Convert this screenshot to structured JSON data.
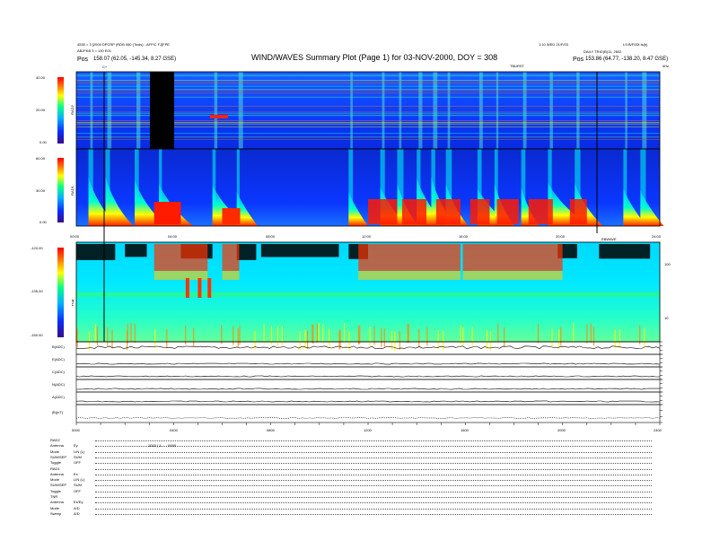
{
  "header": {
    "title": "WIND/WAVES Summary Plot (Page 1) for 03-NOV-2000, DOY = 308",
    "left_line1": "4530 = 3 [2000 DPCRP (RDB 060 (Tools) - AFFIC FJ]FPE",
    "left_line2": "ABJFKB 3 = 130 E01",
    "left_pos_label": "Pos",
    "left_pos_value": "158.07 (62.05, -145.34, 8.27 GSE)",
    "right_line1": "1:10 WED 21/F/03",
    "right_line1b": "LS:B/F0Dt is(b)",
    "right_line2": "DAILY TRIG(B)11, 2602",
    "right_pos_label": "Pos",
    "right_pos_value": "153.86 (64.77, -138.20, 8.47 GSE)",
    "marker_left": "C+",
    "marker_top_right": "TBURST",
    "marker_far_right": "kHz"
  },
  "rad2": {
    "label": "RAD2",
    "ticks": [
      "40.00",
      "20.00",
      "0.00"
    ]
  },
  "rad1": {
    "label": "RAD1",
    "ticks": [
      "60.00",
      "30.00",
      "0.00"
    ]
  },
  "tnr": {
    "label": "TNR",
    "ticks": [
      "-120.00",
      "-135.00",
      "-150.00"
    ],
    "right_ticks": [
      "100",
      "10"
    ],
    "marker": "EBWAVE"
  },
  "time_axis_top": [
    "00:00",
    "04:00",
    "08:00",
    "12:00",
    "16:00",
    "20:00",
    "24:00"
  ],
  "time_axis_bottom": [
    "0000",
    "0400",
    "0800",
    "1200",
    "1600",
    "2000",
    "2400"
  ],
  "line_panels": [
    {
      "label": "B(ADC)",
      "right": [
        "20",
        "10"
      ]
    },
    {
      "label": "E(ADC)",
      "right": [
        "20",
        "10"
      ]
    },
    {
      "label": "C(ADC)",
      "right": [
        "20",
        "10"
      ]
    },
    {
      "label": "N(ADC)",
      "right": [
        "20",
        "10"
      ]
    },
    {
      "label": "A(ADC)",
      "right": [
        "20",
        "10"
      ]
    },
    {
      "label": "|B|(nT)",
      "right": [
        "20",
        "10"
      ]
    }
  ],
  "status_block": [
    {
      "key": "RAD2",
      "value": ""
    },
    {
      "key": "Antenna",
      "value": "Ey"
    },
    {
      "key": "Mode",
      "value": "LIN (L)"
    },
    {
      "key": "SUM/SEP",
      "value": "SUM"
    },
    {
      "key": "Toggle",
      "value": "OFF"
    },
    {
      "key": "RAD1",
      "value": ""
    },
    {
      "key": "Antenna",
      "value": "Ex"
    },
    {
      "key": "Mode",
      "value": "LIN (L)"
    },
    {
      "key": "SUM/SEP",
      "value": "SUM"
    },
    {
      "key": "Toggle",
      "value": "OFF"
    },
    {
      "key": "TNR",
      "value": ""
    },
    {
      "key": "Antenna",
      "value": "Ex/Ey"
    },
    {
      "key": "Mode",
      "value": "A/D"
    },
    {
      "key": "Sweep",
      "value": "A/D"
    }
  ],
  "status_mid_text": "1015 | 1 . . . 0000 .",
  "colors": {
    "low": "#0a2cff",
    "mid": "#00ffff",
    "high": "#ff0000",
    "background_dark": "#000000"
  },
  "chart_data": {
    "type": "heatmap",
    "title": "WIND/WAVES Summary Plot (Page 1) for 03-NOV-2000, DOY = 308",
    "x_range_hours": [
      0,
      24
    ],
    "panels": [
      {
        "name": "RAD2",
        "ylim": [
          0,
          40
        ],
        "units": "dB"
      },
      {
        "name": "RAD1",
        "ylim": [
          0,
          60
        ],
        "units": "dB"
      },
      {
        "name": "TNR",
        "ylim": [
          -150,
          -120
        ],
        "units": "dB"
      }
    ],
    "burst_events_hours": [
      0.5,
      1.2,
      2.4,
      3.4,
      5.6,
      6.6,
      11.2,
      12.5,
      13.2,
      14.0,
      14.6,
      15.2,
      16.5,
      17.2,
      18.3,
      19.4,
      20.5,
      22.5,
      23.2
    ],
    "data_gap_hours": [
      3.0,
      4.1
    ]
  }
}
